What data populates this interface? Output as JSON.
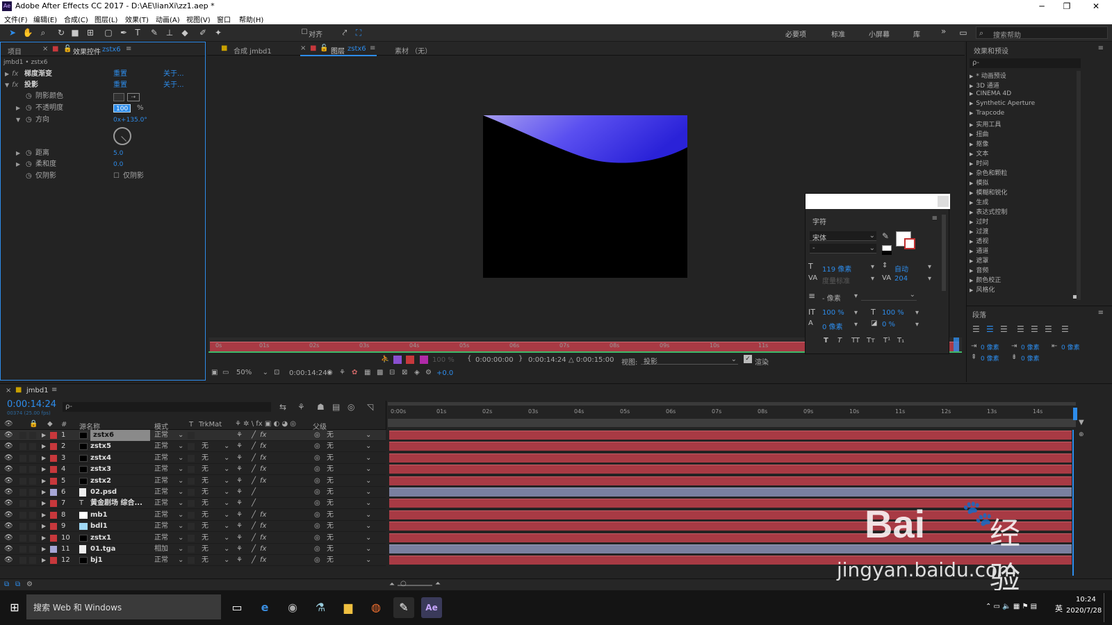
{
  "window": {
    "app_icon": "Ae",
    "title": "Adobe After Effects CC 2017 - D:\\AE\\lianXi\\zz1.aep *",
    "min": "─",
    "max": "❐",
    "close": "✕"
  },
  "menu": [
    "文件(F)",
    "编辑(E)",
    "合成(C)",
    "图层(L)",
    "效果(T)",
    "动画(A)",
    "视图(V)",
    "窗口",
    "帮助(H)"
  ],
  "toolbar": {
    "align_label": "对齐",
    "workspaces": [
      "必要项",
      "标准",
      "小屏幕",
      "库"
    ],
    "more": "»",
    "search_placeholder": "搜索帮助"
  },
  "left_panel": {
    "tab_project": "项目",
    "tab_effects": "效果控件",
    "tab_effects_layer": "zstx6",
    "breadcrumb": "jmbd1 • zstx6",
    "effects": [
      {
        "name": "梯度渐变",
        "reset": "重置",
        "about": "关于..."
      },
      {
        "name": "投影",
        "reset": "重置",
        "about": "关于..."
      }
    ],
    "props": [
      {
        "label": "阴影颜色",
        "value": ""
      },
      {
        "label": "不透明度",
        "value": "100",
        "unit": "%"
      },
      {
        "label": "方向",
        "value": "0x+135.0°"
      },
      {
        "label": "距离",
        "value": "5.0"
      },
      {
        "label": "柔和度",
        "value": "0.0"
      },
      {
        "label": "仅阴影",
        "value": "仅阴影"
      }
    ]
  },
  "viewer": {
    "tab_comp": "合成 jmbd1",
    "tab_layer": "图层",
    "tab_layer_name": "zstx6",
    "tab_footage": "素材 （无）",
    "ruler": [
      "0s",
      "01s",
      "02s",
      "03s",
      "04s",
      "05s",
      "06s",
      "07s",
      "08s",
      "09s",
      "10s",
      "11s"
    ],
    "in_time": "0:00:00:00",
    "out_time": "0:00:14:24",
    "duration": "△ 0:00:15:00",
    "view_label": "视图:",
    "view_value": "投影",
    "render_label": "渲染",
    "opacity": "100 %",
    "zoom": "50%",
    "current_time": "0:00:14:24",
    "exposure": "+0.0"
  },
  "character": {
    "title": "字符",
    "font": "宋体",
    "style": "-",
    "size": "119 像素",
    "leading": "自动",
    "kerning": "度量标准",
    "tracking": "204",
    "stroke": "- 像素",
    "vscale": "100 %",
    "hscale": "100 %",
    "baseline": "0 像素",
    "tsume": "0 %",
    "styles": [
      "T",
      "T",
      "TT",
      "Tт",
      "T¹",
      "T₁"
    ]
  },
  "effects_presets": {
    "title": "效果和预设",
    "search_placeholder": "ρ-",
    "items": [
      "* 动画预设",
      "3D 通道",
      "CINEMA 4D",
      "Synthetic Aperture",
      "Trapcode",
      "实用工具",
      "扭曲",
      "抠像",
      "文本",
      "时间",
      "杂色和颗粒",
      "模拟",
      "模糊和锐化",
      "生成",
      "表达式控制",
      "过时",
      "过渡",
      "透视",
      "通道",
      "遮罩",
      "音频",
      "颜色校正",
      "风格化"
    ]
  },
  "paragraph": {
    "title": "段落",
    "indents": [
      "0 像素",
      "0 像素",
      "0 像素",
      "0 像素",
      "0 像素"
    ]
  },
  "timeline": {
    "tab": "jmbd1",
    "current_time": "0:00:14:24",
    "fps": "00374 (25.00 fps)",
    "search_placeholder": "ρ-",
    "columns": {
      "name": "源名称",
      "mode": "模式",
      "t": "T",
      "trkmat": "TrkMat",
      "parent": "父级"
    },
    "ruler": [
      "0:00s",
      "01s",
      "02s",
      "03s",
      "04s",
      "05s",
      "06s",
      "07s",
      "08s",
      "09s",
      "10s",
      "11s",
      "12s",
      "13s",
      "14s"
    ],
    "layers": [
      {
        "num": "1",
        "name": "zstx6",
        "mode": "正常",
        "trkmat": "",
        "parent": "无",
        "color": "#c7383c",
        "type": "solid",
        "bar": "red",
        "fx": true
      },
      {
        "num": "2",
        "name": "zstx5",
        "mode": "正常",
        "trkmat": "无",
        "parent": "无",
        "color": "#c7383c",
        "type": "solid",
        "bar": "red",
        "fx": true
      },
      {
        "num": "3",
        "name": "zstx4",
        "mode": "正常",
        "trkmat": "无",
        "parent": "无",
        "color": "#c7383c",
        "type": "solid",
        "bar": "red",
        "fx": true
      },
      {
        "num": "4",
        "name": "zstx3",
        "mode": "正常",
        "trkmat": "无",
        "parent": "无",
        "color": "#c7383c",
        "type": "solid",
        "bar": "red",
        "fx": true
      },
      {
        "num": "5",
        "name": "zstx2",
        "mode": "正常",
        "trkmat": "无",
        "parent": "无",
        "color": "#c7383c",
        "type": "solid",
        "bar": "red",
        "fx": true
      },
      {
        "num": "6",
        "name": "02.psd",
        "mode": "正常",
        "trkmat": "无",
        "parent": "无",
        "color": "#a6a6d6",
        "type": "file",
        "bar": "grey",
        "fx": false
      },
      {
        "num": "7",
        "name": "黄金剧场 综合...",
        "mode": "正常",
        "trkmat": "无",
        "parent": "无",
        "color": "#c7383c",
        "type": "text",
        "bar": "red",
        "fx": false
      },
      {
        "num": "8",
        "name": "mb1",
        "mode": "正常",
        "trkmat": "无",
        "parent": "无",
        "color": "#c7383c",
        "type": "white",
        "bar": "red",
        "fx": true
      },
      {
        "num": "9",
        "name": "bdl1",
        "mode": "正常",
        "trkmat": "无",
        "parent": "无",
        "color": "#c7383c",
        "type": "cyan",
        "bar": "red",
        "fx": true
      },
      {
        "num": "10",
        "name": "zstx1",
        "mode": "正常",
        "trkmat": "无",
        "parent": "无",
        "color": "#c7383c",
        "type": "solid",
        "bar": "red",
        "fx": true
      },
      {
        "num": "11",
        "name": "01.tga",
        "mode": "相加",
        "trkmat": "无",
        "parent": "无",
        "color": "#a6a6d6",
        "type": "file",
        "bar": "grey",
        "fx": true
      },
      {
        "num": "12",
        "name": "bj1",
        "mode": "正常",
        "trkmat": "无",
        "parent": "无",
        "color": "#c7383c",
        "type": "solid",
        "bar": "red",
        "fx": true
      }
    ]
  },
  "watermark": {
    "brand": "Bai",
    "brand2": "经验",
    "url": "jingyan.baidu.com"
  },
  "taskbar": {
    "search": "搜索 Web 和 Windows",
    "time": "10:24",
    "date": "2020/7/28",
    "lang": "英"
  },
  "colors": {
    "accent": "#2d8ceb",
    "layer_bar_red": "#a83a44",
    "layer_bar_grey": "#7a80a0",
    "viewer_gradient_start": "#8b82e8",
    "viewer_gradient_end": "#2a22d8"
  }
}
